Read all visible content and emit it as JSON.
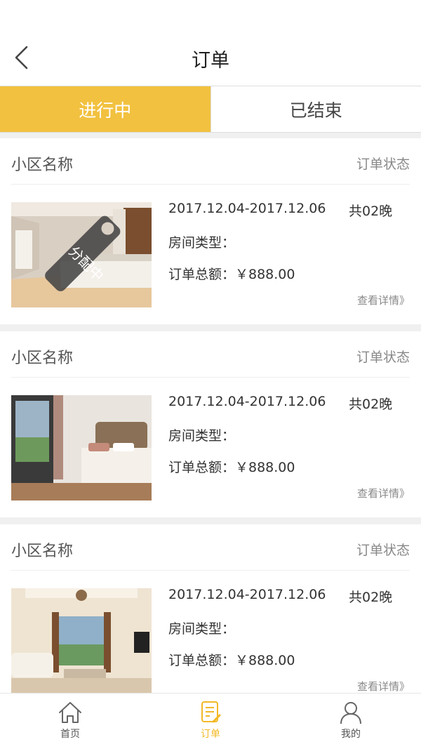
{
  "header": {
    "title": "订单",
    "back_icon": "chevron-left-icon"
  },
  "tabs": [
    {
      "label": "进行中",
      "active": true
    },
    {
      "label": "已结束",
      "active": false
    }
  ],
  "colors": {
    "accent": "#f2c13f",
    "active_nav": "#f2b826"
  },
  "orders": [
    {
      "community_name": "小区名称",
      "status": "订单状态",
      "date_range": "2017.12.04-2017.12.06",
      "nights": "共02晚",
      "room_type": "房间类型：",
      "total": "订单总额：￥888.00",
      "details_link": "查看详情》",
      "tag": "分配中"
    },
    {
      "community_name": "小区名称",
      "status": "订单状态",
      "date_range": "2017.12.04-2017.12.06",
      "nights": "共02晚",
      "room_type": "房间类型：",
      "total": "订单总额：￥888.00",
      "details_link": "查看详情》"
    },
    {
      "community_name": "小区名称",
      "status": "订单状态",
      "date_range": "2017.12.04-2017.12.06",
      "nights": "共02晚",
      "room_type": "房间类型：",
      "total": "订单总额：￥888.00",
      "details_link": "查看详情》"
    }
  ],
  "bottom_nav": [
    {
      "label": "首页",
      "icon": "home-icon",
      "active": false
    },
    {
      "label": "订单",
      "icon": "order-icon",
      "active": true
    },
    {
      "label": "我的",
      "icon": "user-icon",
      "active": false
    }
  ]
}
